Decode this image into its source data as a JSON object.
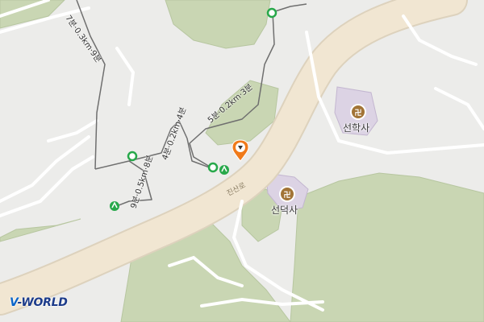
{
  "map": {
    "road_name": "진산로",
    "temples": [
      {
        "name": "선학사",
        "icon": "buddhist-temple-icon",
        "symbol": "卍"
      },
      {
        "name": "선덕사",
        "icon": "buddhist-temple-icon",
        "symbol": "卍"
      }
    ],
    "trail_labels": [
      "5분·0.2km·3분",
      "4분·0.2km·4분",
      "7분·0.3km·9분",
      "9분·0.5km·8분"
    ],
    "logo": {
      "accent": "V",
      "rest": "-WORLD"
    },
    "colors": {
      "background": "#ececea",
      "forest": "#c9d6b3",
      "road": "#f1e6d2",
      "road_edge": "#ddd2bd",
      "temple_area": "#dcd3e4",
      "trail": "#6f6f6f",
      "trail_marker": "#27a84a",
      "location_pin": "#f07a1a",
      "temple_icon": "#a27436"
    }
  }
}
